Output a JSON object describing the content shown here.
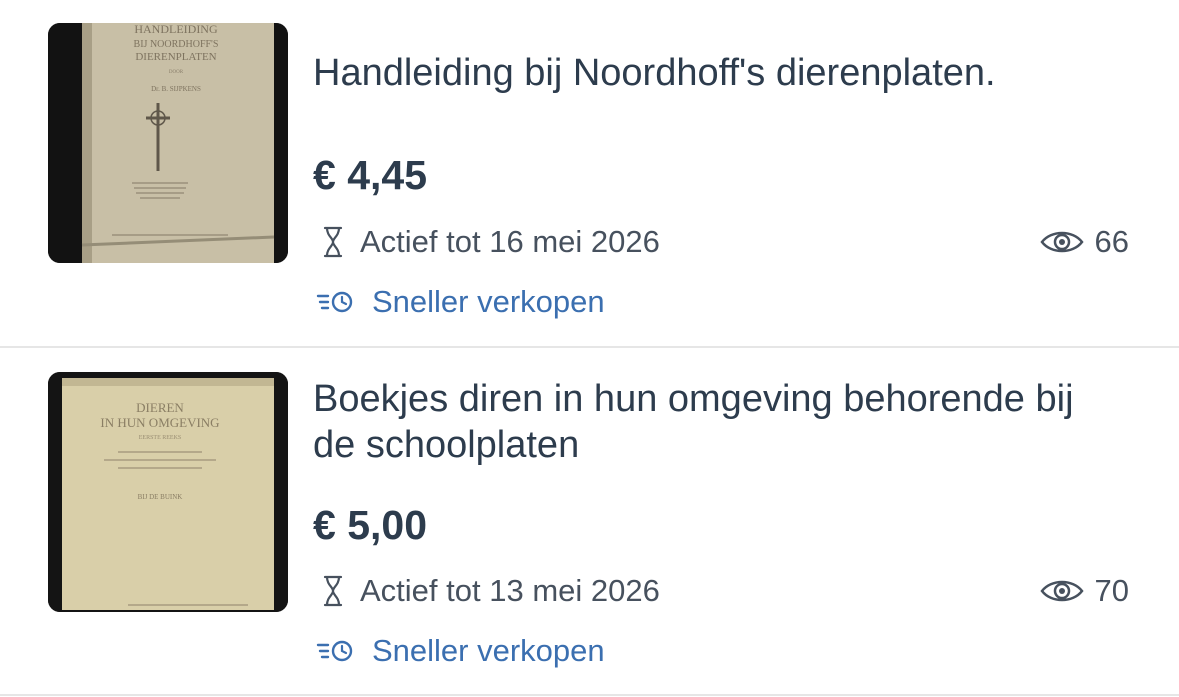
{
  "listings": [
    {
      "title": "Handleiding bij Noordhoff's dierenplaten.",
      "price": "€ 4,45",
      "status": "Actief tot 16 mei 2026",
      "views": "66",
      "action": "Sneller verkopen",
      "cover": {
        "lines": [
          "HANDLEIDING",
          "BIJ NOORDHOFF'S",
          "DIERENPLATEN",
          "DOOR",
          "Dr. B. SIJPKENS"
        ],
        "color": "#c8bfa6"
      }
    },
    {
      "title": "Boekjes diren in hun omgeving behorende bij de schoolplaten",
      "price": "€ 5,00",
      "status": "Actief tot 13 mei 2026",
      "views": "70",
      "action": "Sneller verkopen",
      "cover": {
        "lines": [
          "DIEREN",
          "IN HUN OMGEVING",
          "EERSTE REEKS",
          "BIJ DE BUINK"
        ],
        "color": "#d9cfa9"
      }
    }
  ],
  "icons": {
    "status": "hourglass-icon",
    "views": "eye-icon",
    "action": "boost-timer-icon"
  },
  "colors": {
    "text": "#2d3c4d",
    "secondary": "#47515e",
    "link": "#3b6fb0",
    "divider": "#e6e6e6"
  }
}
